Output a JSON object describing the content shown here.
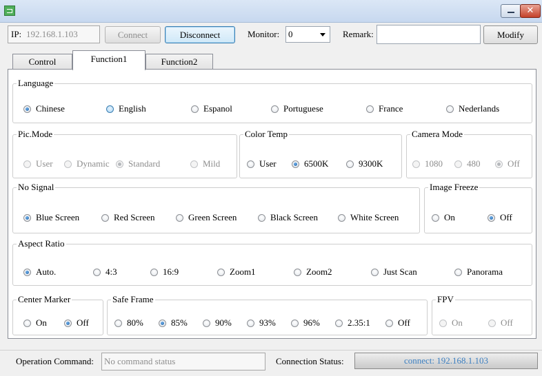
{
  "toolbar": {
    "ip_label": "IP:",
    "ip_value": "192.168.1.103",
    "connect_label": "Connect",
    "disconnect_label": "Disconnect",
    "monitor_label": "Monitor:",
    "monitor_value": "0",
    "remark_label": "Remark:",
    "remark_value": "",
    "modify_label": "Modify"
  },
  "tabs": [
    {
      "label": "Control",
      "active": false
    },
    {
      "label": "Function1",
      "active": true
    },
    {
      "label": "Function2",
      "active": false
    }
  ],
  "groups": {
    "language": {
      "title": "Language",
      "options": [
        {
          "label": "Chinese",
          "checked": true
        },
        {
          "label": "English",
          "checked": false
        },
        {
          "label": "Espanol",
          "checked": false
        },
        {
          "label": "Portuguese",
          "checked": false
        },
        {
          "label": "France",
          "checked": false
        },
        {
          "label": "Nederlands",
          "checked": false
        }
      ]
    },
    "pic_mode": {
      "title": "Pic.Mode",
      "disabled": true,
      "options": [
        {
          "label": "User",
          "checked": false
        },
        {
          "label": "Dynamic",
          "checked": false
        },
        {
          "label": "Standard",
          "checked": true
        },
        {
          "label": "Mild",
          "checked": false
        }
      ]
    },
    "color_temp": {
      "title": "Color Temp",
      "options": [
        {
          "label": "User",
          "checked": false
        },
        {
          "label": "6500K",
          "checked": true
        },
        {
          "label": "9300K",
          "checked": false
        }
      ]
    },
    "camera_mode": {
      "title": "Camera Mode",
      "disabled": true,
      "options": [
        {
          "label": "1080",
          "checked": false
        },
        {
          "label": "480",
          "checked": false
        },
        {
          "label": "Off",
          "checked": true
        }
      ]
    },
    "no_signal": {
      "title": "No Signal",
      "options": [
        {
          "label": "Blue Screen",
          "checked": true
        },
        {
          "label": "Red Screen",
          "checked": false
        },
        {
          "label": "Green Screen",
          "checked": false
        },
        {
          "label": "Black Screen",
          "checked": false
        },
        {
          "label": "White Screen",
          "checked": false
        }
      ]
    },
    "image_freeze": {
      "title": "Image Freeze",
      "options": [
        {
          "label": "On",
          "checked": false
        },
        {
          "label": "Off",
          "checked": true
        }
      ]
    },
    "aspect_ratio": {
      "title": "Aspect Ratio",
      "options": [
        {
          "label": "Auto.",
          "checked": true
        },
        {
          "label": "4:3",
          "checked": false
        },
        {
          "label": "16:9",
          "checked": false
        },
        {
          "label": "Zoom1",
          "checked": false
        },
        {
          "label": "Zoom2",
          "checked": false
        },
        {
          "label": "Just Scan",
          "checked": false
        },
        {
          "label": "Panorama",
          "checked": false
        }
      ]
    },
    "center_marker": {
      "title": "Center Marker",
      "options": [
        {
          "label": "On",
          "checked": false
        },
        {
          "label": "Off",
          "checked": true
        }
      ]
    },
    "safe_frame": {
      "title": "Safe Frame",
      "options": [
        {
          "label": "80%",
          "checked": false
        },
        {
          "label": "85%",
          "checked": true
        },
        {
          "label": "90%",
          "checked": false
        },
        {
          "label": "93%",
          "checked": false
        },
        {
          "label": "96%",
          "checked": false
        },
        {
          "label": "2.35:1",
          "checked": false
        },
        {
          "label": "Off",
          "checked": false
        }
      ]
    },
    "fpv": {
      "title": "FPV",
      "disabled": true,
      "options": [
        {
          "label": "On",
          "checked": false
        },
        {
          "label": "Off",
          "checked": false
        }
      ]
    }
  },
  "status": {
    "operation_label": "Operation Command:",
    "operation_value": "No command status",
    "connection_label": "Connection Status:",
    "connection_value": "connect: 192.168.1.103"
  }
}
